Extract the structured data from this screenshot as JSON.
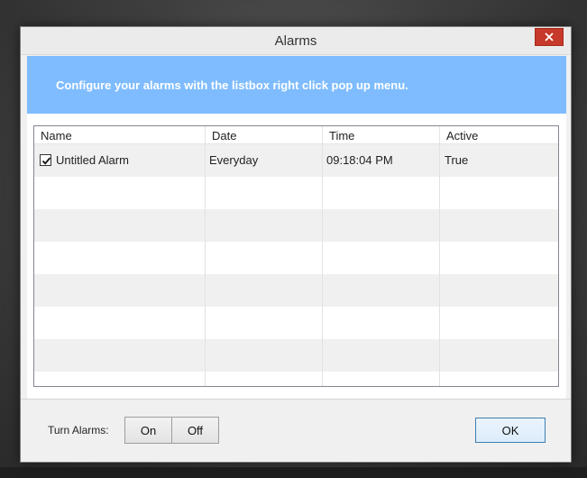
{
  "window": {
    "title": "Alarms"
  },
  "banner": {
    "text": "Configure your alarms with the listbox right click pop up menu."
  },
  "list": {
    "columns": [
      "Name",
      "Date",
      "Time",
      "Active"
    ],
    "rows": [
      {
        "checked": true,
        "name": "Untitled Alarm",
        "date": "Everyday",
        "time": "09:18:04 PM",
        "active": "True"
      }
    ]
  },
  "footer": {
    "turn_label": "Turn Alarms:",
    "on_label": "On",
    "off_label": "Off",
    "ok_label": "OK"
  },
  "colors": {
    "banner": "#7fbcff",
    "close_button": "#c7392a",
    "row_alt": "#f0f0f0"
  },
  "icons": {
    "close": "close-icon",
    "check": "checkmark-icon"
  }
}
